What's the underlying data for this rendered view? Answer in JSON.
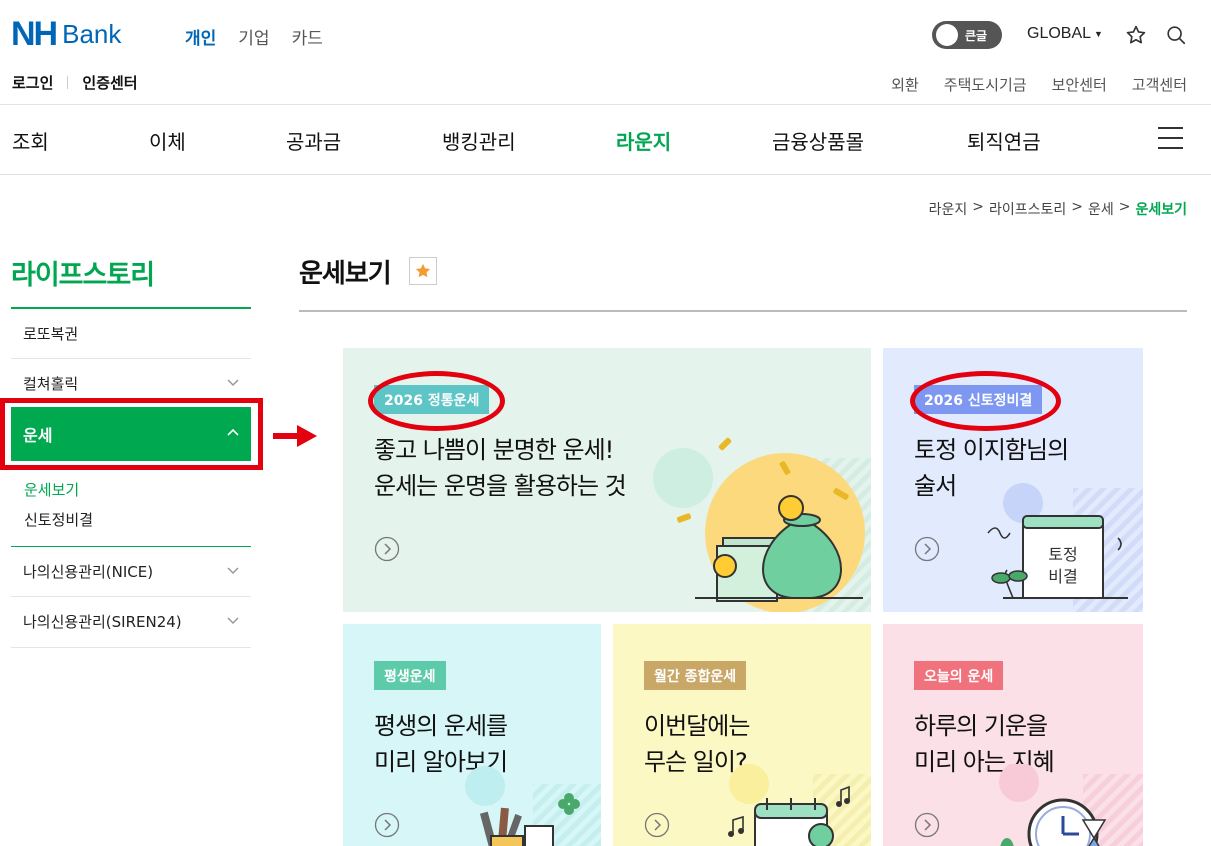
{
  "header": {
    "logo_nh": "NH",
    "logo_bank": "Bank",
    "biz_tabs": [
      "개인",
      "기업",
      "카드"
    ],
    "toggle_label": "큰글",
    "global_label": "GLOBAL",
    "login": "로그인",
    "cert_center": "인증센터",
    "util_links": [
      "외환",
      "주택도시기금",
      "보안센터",
      "고객센터"
    ]
  },
  "gnb": [
    "조회",
    "이체",
    "공과금",
    "뱅킹관리",
    "라운지",
    "금융상품몰",
    "퇴직연금"
  ],
  "breadcrumb": [
    "라운지",
    "라이프스토리",
    "운세",
    "운세보기"
  ],
  "breadcrumb_sep": ">",
  "lnb": {
    "title": "라이프스토리",
    "items": [
      "로또복권",
      "컬쳐홀릭",
      "운세",
      "나의신용관리(NICE)",
      "나의신용관리(SIREN24)"
    ],
    "sub_items": [
      "운세보기",
      "신토정비결"
    ]
  },
  "page": {
    "title": "운세보기"
  },
  "cards": [
    {
      "tag": "2026 정통운세",
      "lines": [
        "좋고 나쁨이 분명한 운세!",
        "운세는 운명을 활용하는 것"
      ]
    },
    {
      "tag": "2026 신토정비결",
      "lines": [
        "토정 이지함님의",
        "술서"
      ],
      "illu_text": [
        "토정",
        "비결"
      ]
    },
    {
      "tag": "평생운세",
      "lines": [
        "평생의 운세를",
        "미리 알아보기"
      ]
    },
    {
      "tag": "월간 종합운세",
      "lines": [
        "이번달에는",
        "무슨 일이?"
      ]
    },
    {
      "tag": "오늘의 운세",
      "lines": [
        "하루의 기운을",
        "미리 아는 지혜"
      ]
    }
  ],
  "colors": {
    "brand_blue": "#0067b8",
    "brand_green": "#00a650",
    "highlight_red": "#e3000f"
  }
}
